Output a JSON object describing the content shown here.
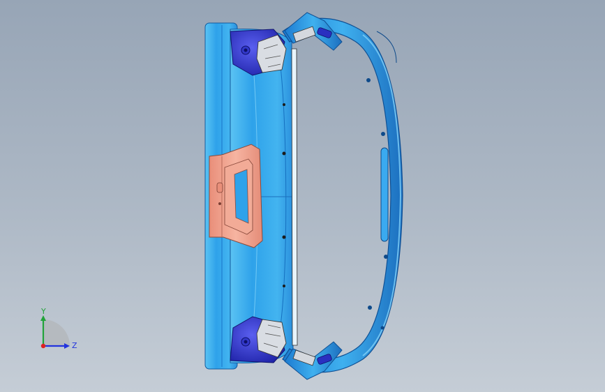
{
  "viewport": {
    "background_top": "#97a5b6",
    "background_bottom": "#c5cdd6"
  },
  "model": {
    "description_icon": "cad-part-icon",
    "colors": {
      "body": "#2f9fe6",
      "body_dark": "#1a6fc2",
      "body_light": "#6cc8f5",
      "bracket": "#2a2fc0",
      "pad": "#f0a08a"
    }
  },
  "triad": {
    "y_label": "Y",
    "z_label": "Z",
    "y_color": "#22a33a",
    "z_color": "#2233dd",
    "x_color": "#dd2222"
  }
}
